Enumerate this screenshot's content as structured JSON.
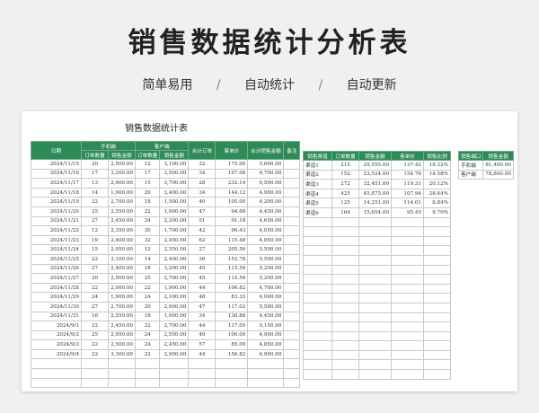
{
  "page": {
    "title": "销售数据统计分析表",
    "taglines": [
      "简单易用",
      "自动统计",
      "自动更新"
    ],
    "separator": "/"
  },
  "sheet": {
    "title": "销售数据统计表",
    "main_table": {
      "headers": {
        "date": "日期",
        "mobile_group": "手机端",
        "client_group": "客户端",
        "orders": "订单数量",
        "sales": "销售金额",
        "total_orders": "合计订单",
        "unit_price": "客单价",
        "total_sales": "合计销售金额",
        "remark": "备注"
      },
      "rows": [
        [
          "2024/11/15",
          "20",
          "2,500.00",
          "12",
          "3,100.00",
          "32",
          "175.00",
          "5,600.00"
        ],
        [
          "2024/11/16",
          "17",
          "3,200.00",
          "17",
          "3,500.00",
          "34",
          "197.06",
          "6,700.00"
        ],
        [
          "2024/11/17",
          "13",
          "2,000.00",
          "15",
          "3,700.00",
          "28",
          "232.14",
          "6,500.00"
        ],
        [
          "2024/11/18",
          "14",
          "1,900.00",
          "20",
          "3,400.00",
          "34",
          "144.12",
          "4,900.00"
        ],
        [
          "2024/11/19",
          "22",
          "2,700.00",
          "18",
          "1,500.00",
          "40",
          "105.00",
          "4,200.00"
        ],
        [
          "2024/11/20",
          "25",
          "2,550.00",
          "22",
          "1,900.00",
          "47",
          "94.68",
          "4,450.00"
        ],
        [
          "2024/11/21",
          "27",
          "2,450.00",
          "24",
          "2,200.00",
          "51",
          "91.18",
          "4,650.00"
        ],
        [
          "2024/11/22",
          "12",
          "2,350.00",
          "30",
          "1,700.00",
          "42",
          "96.43",
          "4,050.00"
        ],
        [
          "2024/11/23",
          "19",
          "2,400.00",
          "32",
          "2,450.00",
          "62",
          "115.48",
          "4,850.00"
        ],
        [
          "2024/11/24",
          "15",
          "2,950.00",
          "12",
          "2,550.00",
          "27",
          "205.56",
          "5,500.00"
        ],
        [
          "2024/11/25",
          "22",
          "3,100.00",
          "14",
          "2,400.00",
          "36",
          "152.78",
          "5,500.00"
        ],
        [
          "2024/11/26",
          "27",
          "2,400.00",
          "18",
          "3,200.00",
          "45",
          "115.56",
          "5,200.00"
        ],
        [
          "2024/11/27",
          "20",
          "2,500.00",
          "25",
          "2,700.00",
          "45",
          "115.56",
          "5,200.00"
        ],
        [
          "2024/11/28",
          "22",
          "2,000.00",
          "22",
          "1,900.00",
          "44",
          "106.82",
          "4,700.00"
        ],
        [
          "2024/11/29",
          "24",
          "1,900.00",
          "24",
          "2,100.00",
          "48",
          "83.33",
          "4,000.00"
        ],
        [
          "2024/11/30",
          "27",
          "2,700.00",
          "20",
          "2,000.00",
          "47",
          "117.02",
          "5,500.00"
        ],
        [
          "2024/11/31",
          "16",
          "2,550.00",
          "18",
          "1,900.00",
          "34",
          "130.88",
          "4,450.00"
        ],
        [
          "2024/9/1",
          "22",
          "2,450.00",
          "22",
          "2,700.00",
          "44",
          "117.05",
          "5,150.00"
        ],
        [
          "2024/9/2",
          "25",
          "2,950.00",
          "24",
          "2,550.00",
          "49",
          "100.00",
          "4,900.00"
        ],
        [
          "2024/9/3",
          "22",
          "2,500.00",
          "24",
          "2,450.00",
          "57",
          "85.09",
          "4,850.00"
        ],
        [
          "2024/9/4",
          "22",
          "3,300.00",
          "22",
          "2,900.00",
          "44",
          "156.82",
          "6,900.00"
        ]
      ]
    },
    "channel_table": {
      "headers": [
        "销售渠道",
        "订单数量",
        "销售金额",
        "客单价",
        "销售比例"
      ],
      "rows": [
        [
          "渠道1",
          "215",
          "29,555.00",
          "137.42",
          "18.32%"
        ],
        [
          "渠道2",
          "152",
          "23,524.00",
          "154.76",
          "14.58%"
        ],
        [
          "渠道3",
          "272",
          "32,451.00",
          "119.31",
          "20.12%"
        ],
        [
          "渠道4",
          "425",
          "45,875.00",
          "107.94",
          "28.44%"
        ],
        [
          "渠道5",
          "125",
          "14,251.00",
          "114.01",
          "8.84%"
        ],
        [
          "渠道6",
          "164",
          "15,654.00",
          "95.45",
          "9.70%"
        ]
      ]
    },
    "terminal_table": {
      "headers": [
        "销售端口",
        "销售金额"
      ],
      "rows": [
        [
          "手机端",
          "81,400.00"
        ],
        [
          "客户端",
          "78,800.00"
        ]
      ]
    }
  }
}
